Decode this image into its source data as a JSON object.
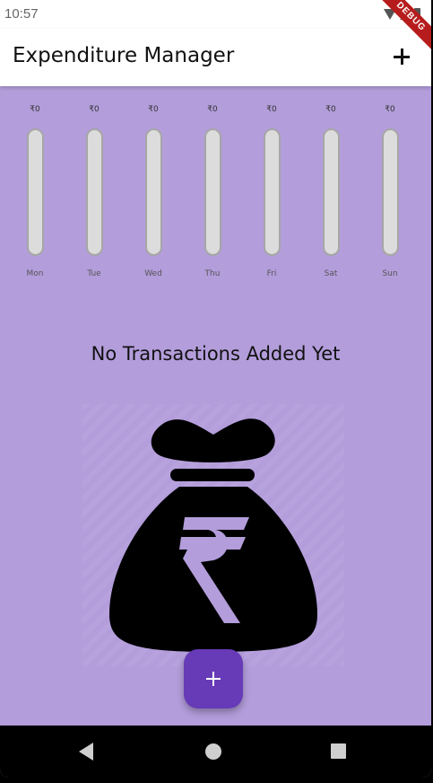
{
  "status_bar": {
    "time": "10:57"
  },
  "debug_banner": "DEBUG",
  "app_bar": {
    "title": "Expenditure Manager",
    "add_icon": "plus-icon"
  },
  "chart_data": {
    "type": "bar",
    "categories": [
      "Mon",
      "Tue",
      "Wed",
      "Thu",
      "Fri",
      "Sat",
      "Sun"
    ],
    "values": [
      0,
      0,
      0,
      0,
      0,
      0,
      0
    ],
    "amount_labels": [
      "₹0",
      "₹0",
      "₹0",
      "₹0",
      "₹0",
      "₹0",
      "₹0"
    ],
    "title": "",
    "xlabel": "",
    "ylabel": ""
  },
  "empty_state": {
    "message": "No Transactions Added Yet",
    "illustration": "rupee-money-bag"
  },
  "fab": {
    "icon": "plus-icon"
  },
  "nav_bar": {
    "icons": [
      "back-icon",
      "home-icon",
      "recents-icon"
    ]
  },
  "colors": {
    "background": "#b39ddb",
    "primary": "#673ab7",
    "appbar": "#ffffff",
    "bar_track": "#dcdcdc"
  }
}
